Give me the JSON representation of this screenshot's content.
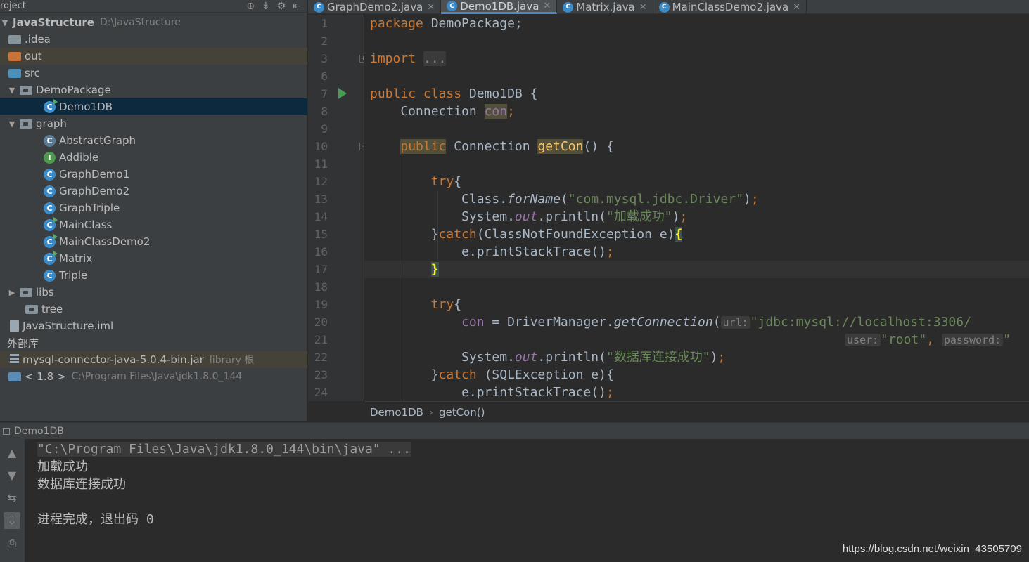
{
  "project": {
    "title": "roject",
    "root": {
      "name": "JavaStructure",
      "path": "D:\\JavaStructure"
    },
    "items": [
      {
        "label": ".idea"
      },
      {
        "label": "out"
      },
      {
        "label": "src"
      },
      {
        "label": "DemoPackage"
      },
      {
        "label": "Demo1DB"
      },
      {
        "label": "graph"
      },
      {
        "label": "AbstractGraph"
      },
      {
        "label": "Addible"
      },
      {
        "label": "GraphDemo1"
      },
      {
        "label": "GraphDemo2"
      },
      {
        "label": "GraphTriple"
      },
      {
        "label": "MainClass"
      },
      {
        "label": "MainClassDemo2"
      },
      {
        "label": "Matrix"
      },
      {
        "label": "Triple"
      },
      {
        "label": "libs"
      },
      {
        "label": "tree"
      },
      {
        "label": "JavaStructure.iml"
      }
    ],
    "external": {
      "label": "外部库",
      "jar": "mysql-connector-java-5.0.4-bin.jar",
      "jar_note": "library 根",
      "jdk": "< 1.8 >",
      "jdk_path": "C:\\Program Files\\Java\\jdk1.8.0_144"
    }
  },
  "tabs": [
    {
      "label": "GraphDemo2.java"
    },
    {
      "label": "Demo1DB.java"
    },
    {
      "label": "Matrix.java"
    },
    {
      "label": "MainClassDemo2.java"
    }
  ],
  "editor": {
    "lines": [
      "1",
      "2",
      "3",
      "6",
      "7",
      "8",
      "9",
      "10",
      "11",
      "12",
      "13",
      "14",
      "15",
      "16",
      "17",
      "18",
      "19",
      "20",
      "21",
      "22",
      "23",
      "24"
    ],
    "code": {
      "l1_kw": "package",
      "l1_rest": " DemoPackage;",
      "l3_kw": "import",
      "l3_fold": "...",
      "l7_kw": "public class",
      "l7_rest": " Demo1DB {",
      "l8_a": "    Connection ",
      "l8_var": "con",
      "l8_b": ";",
      "l10_kw": "public",
      "l10_a": " Connection ",
      "l10_fn": "getCon",
      "l10_b": "() {",
      "l12_kw": "try",
      "l12_b": "{",
      "l13_a": "            Class.",
      "l13_m": "forName",
      "l13_b": "(",
      "l13_s": "\"com.mysql.jdbc.Driver\"",
      "l13_c": ")",
      "l14_a": "            System.",
      "l14_f": "out",
      "l14_b": ".println(",
      "l14_s": "\"加载成功\"",
      "l14_c": ")",
      "l15_a": "}",
      "l15_kw": "catch",
      "l15_b": "(ClassNotFoundException e)",
      "l15_c": "{",
      "l16_a": "            e.printStackTrace()",
      "l17_a": "}",
      "l19_kw": "try",
      "l19_b": "{",
      "l20_var": "con",
      "l20_a": " = DriverManager.",
      "l20_m": "getConnection",
      "l20_b": "(",
      "l20_hint": "url:",
      "l20_s": "\"jdbc:mysql://localhost:3306/",
      "l21_hint1": "user:",
      "l21_s1": "\"root\"",
      "l21_c": ",",
      "l21_hint2": "password:",
      "l21_s2": "\"",
      "l22_a": "            System.",
      "l22_f": "out",
      "l22_b": ".println(",
      "l22_s": "\"数据库连接成功\"",
      "l22_c": ")",
      "l23_a": "}",
      "l23_kw": "catch",
      "l23_b": " (SQLException e){",
      "l24_a": "            e.printStackTrace()"
    }
  },
  "breadcrumb": {
    "class": "Demo1DB",
    "method": "getCon()"
  },
  "run": {
    "title": "Demo1DB",
    "console": [
      "\"C:\\Program Files\\Java\\jdk1.8.0_144\\bin\\java\" ...",
      "加载成功",
      "数据库连接成功",
      "",
      "进程完成，退出码 0"
    ]
  },
  "watermark": "https://blog.csdn.net/weixin_43505709",
  "colors": {
    "keyword": "#cc7832",
    "string": "#6a8759",
    "field": "#9876aa",
    "background": "#2b2b2b",
    "panel": "#3c3f41"
  }
}
